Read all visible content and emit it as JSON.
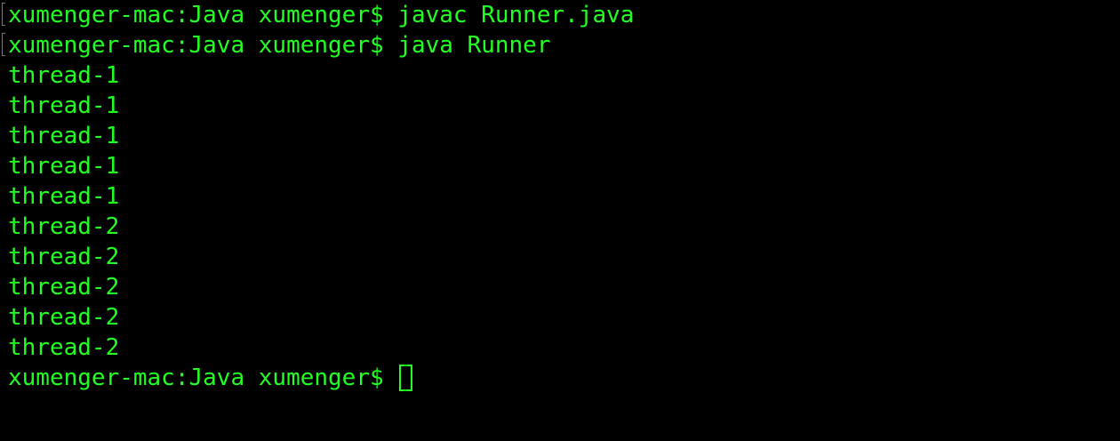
{
  "terminal": {
    "text_color": "#22ff22",
    "background": "#000000",
    "lines": [
      {
        "prompt": "xumenger-mac:Java xumenger$ ",
        "command": "javac Runner.java"
      },
      {
        "prompt": "xumenger-mac:Java xumenger$ ",
        "command": "java Runner"
      },
      {
        "output": "thread-1"
      },
      {
        "output": "thread-1"
      },
      {
        "output": "thread-1"
      },
      {
        "output": "thread-1"
      },
      {
        "output": "thread-1"
      },
      {
        "output": "thread-2"
      },
      {
        "output": "thread-2"
      },
      {
        "output": "thread-2"
      },
      {
        "output": "thread-2"
      },
      {
        "output": "thread-2"
      },
      {
        "prompt": "xumenger-mac:Java xumenger$ ",
        "command": ""
      }
    ]
  }
}
